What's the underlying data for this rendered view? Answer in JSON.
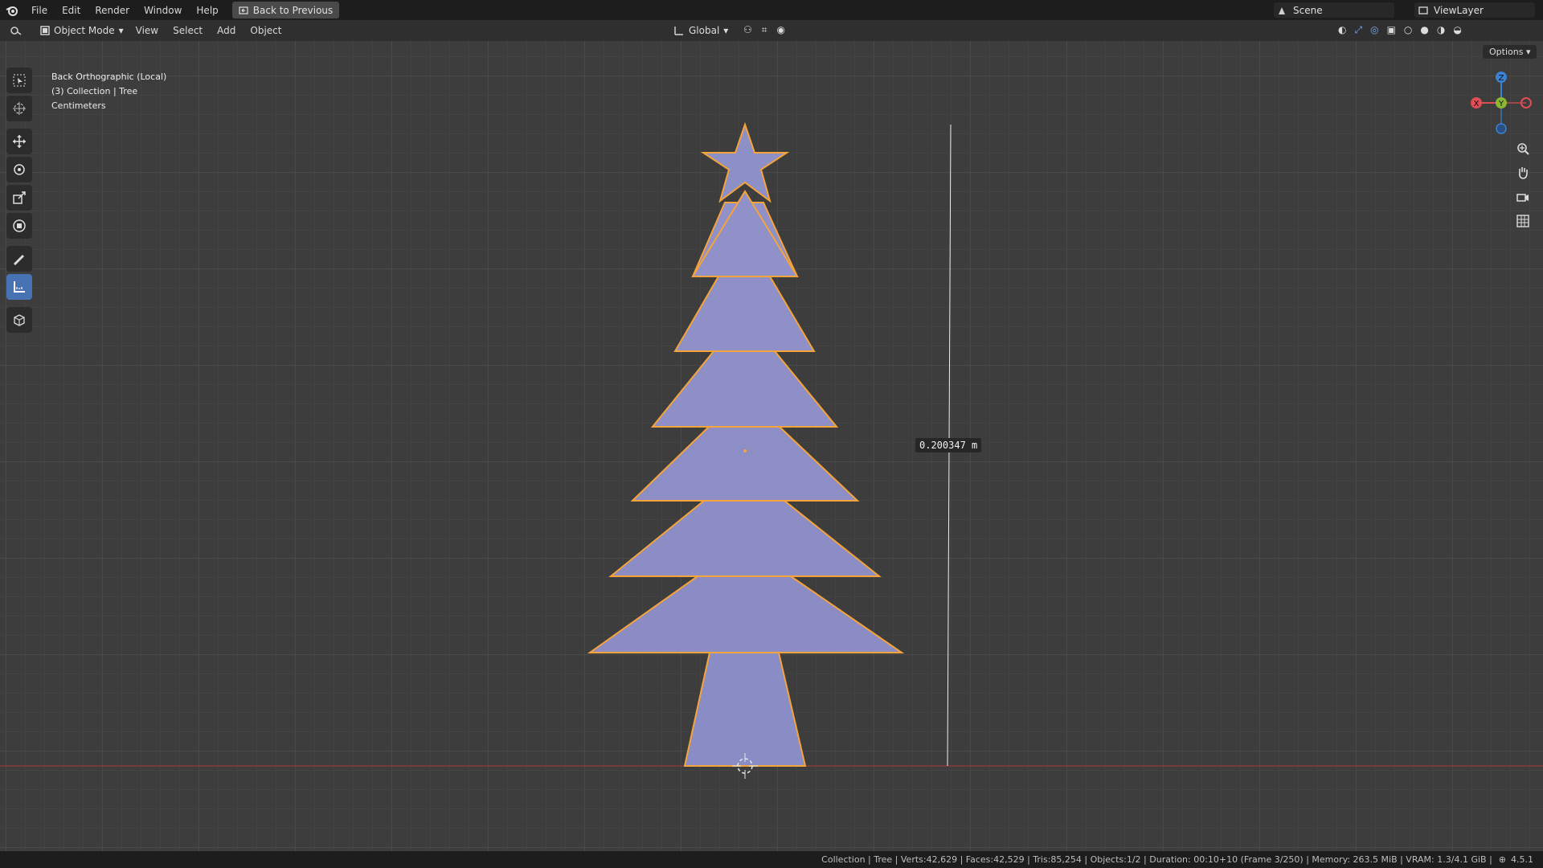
{
  "topbar": {
    "menus": [
      "File",
      "Edit",
      "Render",
      "Window",
      "Help"
    ],
    "back_label": "Back to Previous",
    "scene": "Scene",
    "view_layer": "ViewLayer"
  },
  "header": {
    "mode": "Object Mode",
    "menus": [
      "View",
      "Select",
      "Add",
      "Object"
    ],
    "orientation": "Global"
  },
  "viewport": {
    "view_name": "Back Orthographic (Local)",
    "collection_line": "(3) Collection | Tree",
    "units": "Centimeters",
    "options_label": "Options",
    "measurement": "0.200347 m",
    "gizmo_axes": [
      "X",
      "Y",
      "Z"
    ]
  },
  "status": {
    "text": "Collection | Tree | Verts:42,629 | Faces:42,529 | Tris:85,254 | Objects:1/2 | Duration: 00:10+10 (Frame 3/250) | Memory: 263.5 MiB | VRAM: 1.3/4.1 GiB |",
    "version": "4.5.1"
  },
  "colors": {
    "accent": "#4772b3",
    "selection_outline": "#f5a33b",
    "tree_fill": "#8a8cc2",
    "x_axis": "#e14d55",
    "y_axis": "#8ab832",
    "z_axis": "#3b82d6"
  }
}
